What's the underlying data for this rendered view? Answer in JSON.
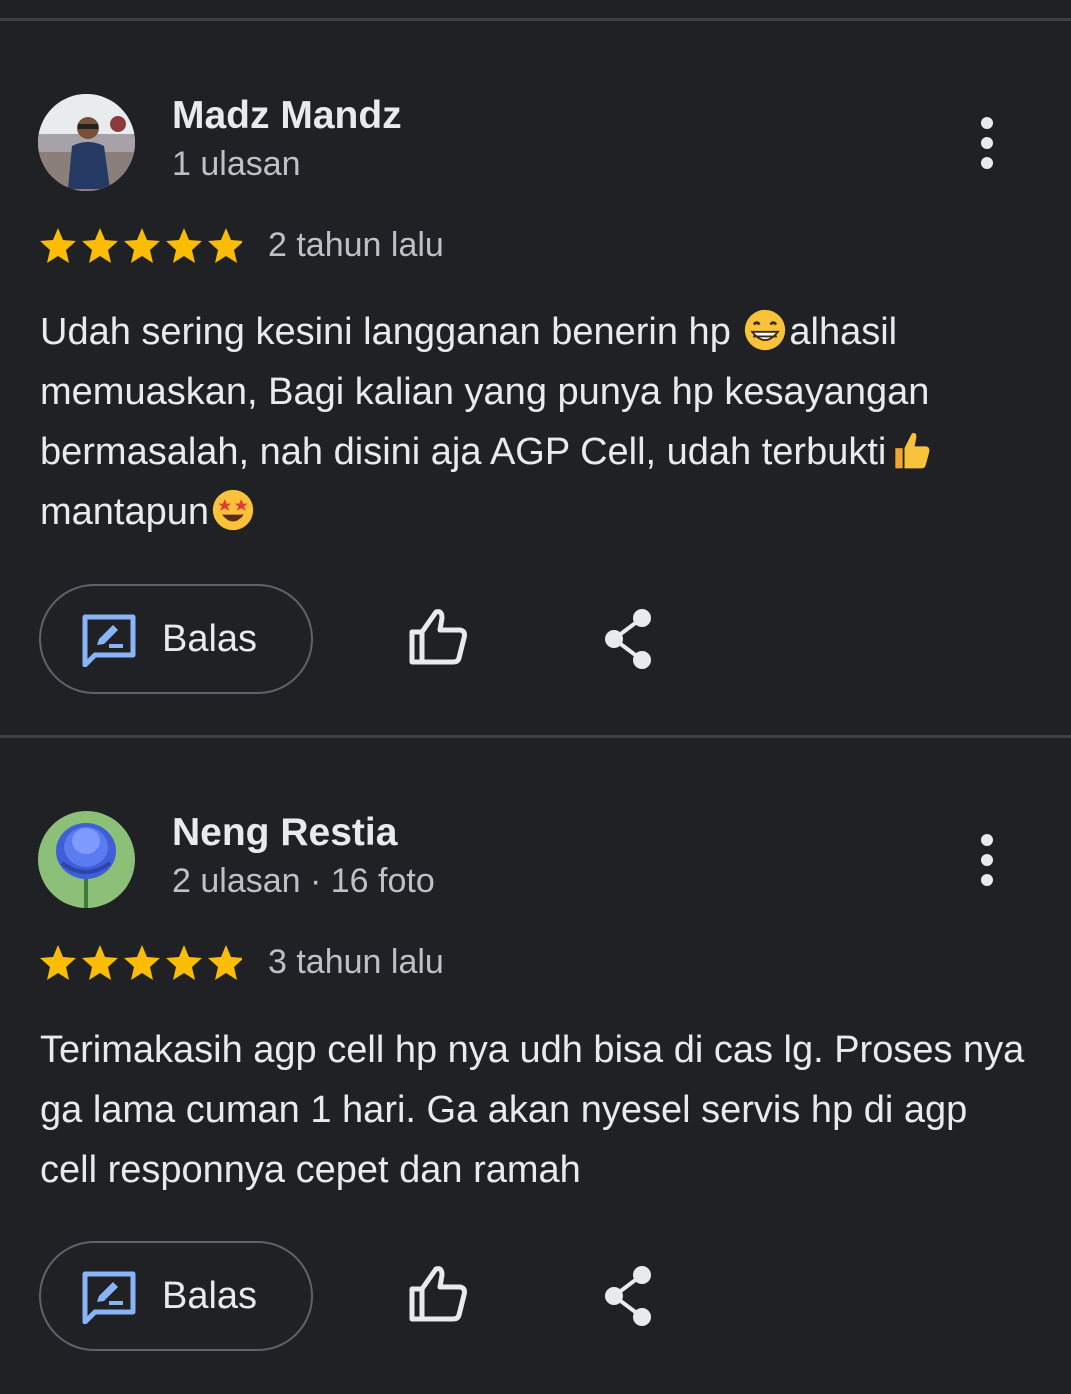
{
  "reviews": [
    {
      "author": "Madz Mandz",
      "meta": "1 ulasan",
      "rating": 5,
      "date": "2 tahun lalu",
      "text_parts": [
        "Udah sering kesini langganan benerin hp ",
        "alhasil memuaskan, Bagi kalian yang punya hp kesayangan bermasalah, nah disini aja AGP Cell, udah terbukti",
        "mantapun"
      ],
      "emojis": [
        "grinning-face",
        "thumbs-up",
        "star-struck"
      ],
      "avatar": "photo-person-icon",
      "reply_label": "Balas"
    },
    {
      "author": "Neng Restia",
      "meta": "2 ulasan · 16 foto",
      "rating": 5,
      "date": "3 tahun lalu",
      "text": "Terimakasih agp cell hp nya udh bisa di cas lg. Proses nya ga lama cuman 1 hari. Ga akan nyesel servis hp di agp cell responnya cepet dan ramah",
      "avatar": "blue-flower-icon",
      "reply_label": "Balas"
    }
  ],
  "colors": {
    "background": "#202124",
    "divider": "#3c4043",
    "star": "#fbbc04",
    "accent": "#8ab4f8",
    "text": "#e8eaed",
    "secondary_text": "#bdc1c6"
  }
}
